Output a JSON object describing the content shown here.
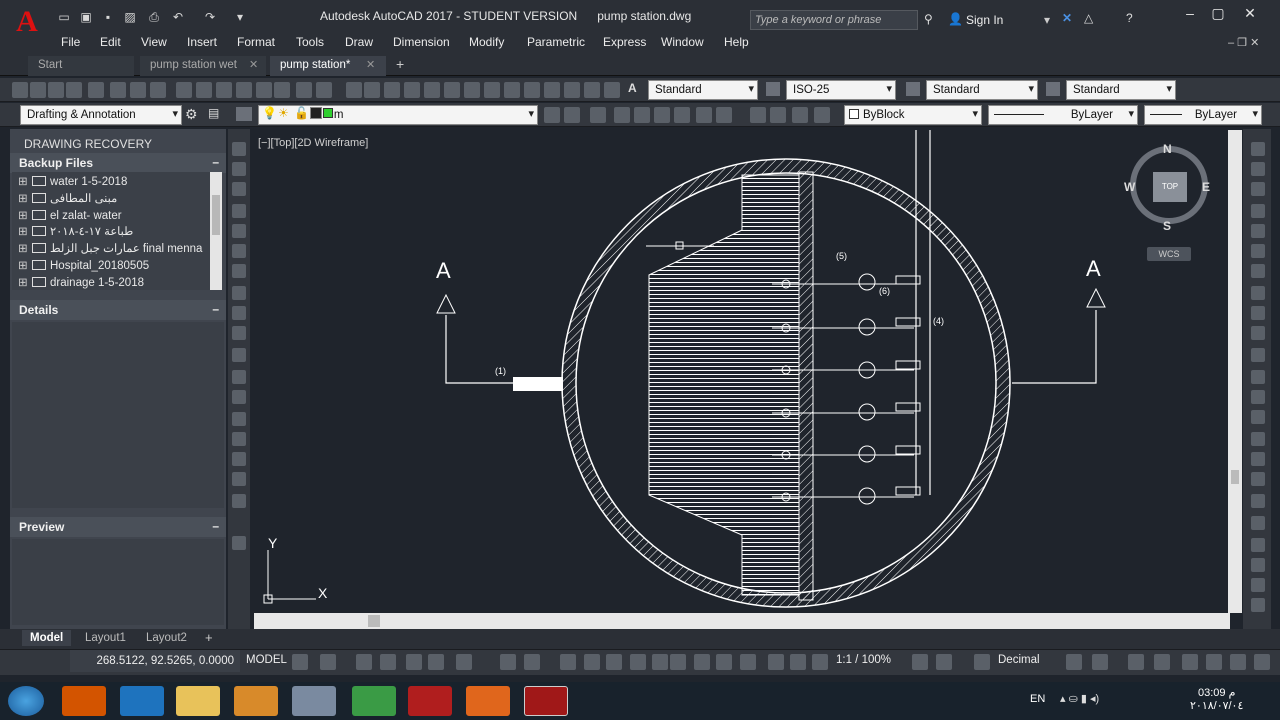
{
  "window": {
    "title": "Autodesk AutoCAD 2017 - STUDENT VERSION      pump station.dwg",
    "search_placeholder": "Type a keyword or phrase",
    "signin_label": "Sign In"
  },
  "menubar": [
    "File",
    "Edit",
    "View",
    "Insert",
    "Format",
    "Tools",
    "Draw",
    "Dimension",
    "Modify",
    "Parametric",
    "Express",
    "Window",
    "Help"
  ],
  "doc_tabs": [
    {
      "label": "Start",
      "active": false
    },
    {
      "label": "pump station wet",
      "active": false
    },
    {
      "label": "pump station*",
      "active": true
    }
  ],
  "toolbar_styles": {
    "text_style": "Standard",
    "dim_style": "ISO-25",
    "table_style": "Standard",
    "multileader_style": "Standard"
  },
  "toolbar_layers": {
    "workspace": "Drafting & Annotation",
    "layer": "Dim",
    "color": "ByBlock",
    "linetype": "ByLayer",
    "lineweight": "ByLayer"
  },
  "recovery_panel": {
    "title": "DRAWING RECOVERY MANAGER",
    "backup_section": "Backup Files",
    "files": [
      "water 1-5-2018",
      "مبنى المطافى",
      "el zalat- water",
      "طباعة ١٧-٤-٢٠١٨",
      "عمارات جبل الزلط final menna",
      "Hospital_20180505",
      "drainage 1-5-2018"
    ],
    "details_section": "Details",
    "preview_section": "Preview",
    "collapse_symbol": "–"
  },
  "viewport": {
    "label": "[−][Top][2D Wireframe]",
    "viewcube": {
      "n": "N",
      "s": "S",
      "e": "E",
      "w": "W",
      "top": "TOP",
      "ucs": "WCS"
    },
    "section_labels": [
      "A",
      "A"
    ],
    "callouts": [
      "(1)",
      "(4)",
      "(5)",
      "(6)"
    ],
    "ucs": {
      "x": "X",
      "y": "Y"
    }
  },
  "layout_tabs": [
    {
      "label": "Model",
      "active": true
    },
    {
      "label": "Layout1",
      "active": false
    },
    {
      "label": "Layout2",
      "active": false
    }
  ],
  "status": {
    "coords": "268.5122, 92.5265, 0.0000",
    "mode": "MODEL",
    "scale": "1:1 / 100%",
    "units": "Decimal"
  },
  "taskbar": {
    "lang": "EN",
    "time": "03:09 م",
    "date": "٢٠١٨/٠٧/٠٤"
  },
  "colors": {
    "accent": "#d11a1a",
    "canvas": "#1f242c",
    "lines": "#ffffff"
  }
}
